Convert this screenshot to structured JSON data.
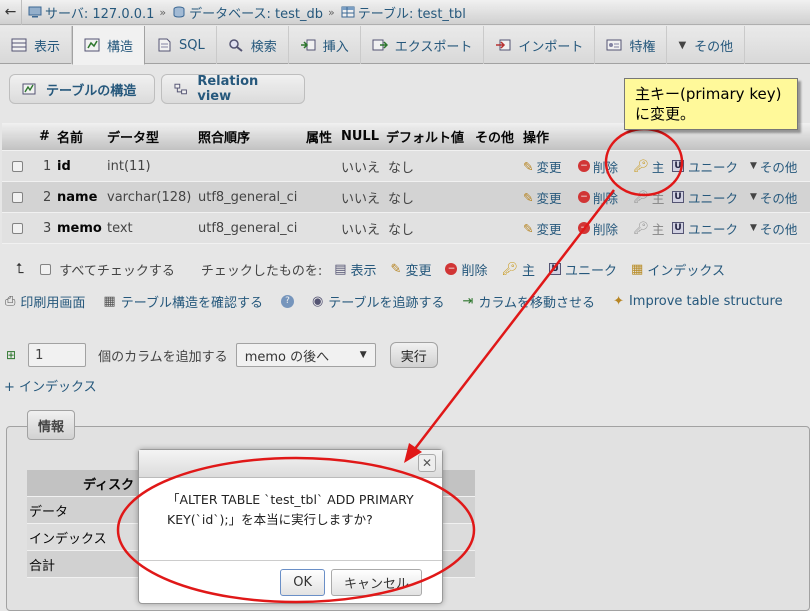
{
  "breadcrumb": {
    "server": "サーバ: 127.0.0.1",
    "database": "データベース: test_db",
    "table": "テーブル: test_tbl"
  },
  "tabs": [
    {
      "label": "表示"
    },
    {
      "label": "構造"
    },
    {
      "label": "SQL"
    },
    {
      "label": "検索"
    },
    {
      "label": "挿入"
    },
    {
      "label": "エクスポート"
    },
    {
      "label": "インポート"
    },
    {
      "label": "特権"
    },
    {
      "label": "その他"
    }
  ],
  "subnav": {
    "structure": "テーブルの構造",
    "relation": "Relation view"
  },
  "table": {
    "headers": [
      "#",
      "名前",
      "データ型",
      "照合順序",
      "属性",
      "NULL",
      "デフォルト値",
      "その他",
      "操作"
    ],
    "rows": [
      {
        "num": "1",
        "name": "id",
        "type": "int(11)",
        "collation": "",
        "null": "いいえ",
        "default": "なし"
      },
      {
        "num": "2",
        "name": "name",
        "type": "varchar(128)",
        "collation": "utf8_general_ci",
        "null": "いいえ",
        "default": "なし"
      },
      {
        "num": "3",
        "name": "memo",
        "type": "text",
        "collation": "utf8_general_ci",
        "null": "いいえ",
        "default": "なし"
      }
    ],
    "actions": {
      "change": "変更",
      "drop": "削除",
      "primary": "主",
      "unique": "ユニーク",
      "more": "その他"
    }
  },
  "checkall": {
    "check_all": "すべてチェックする",
    "with_selected": "チェックしたものを:",
    "browse": "表示",
    "change": "変更",
    "drop": "削除",
    "primary": "主",
    "unique": "ユニーク",
    "index": "インデックス"
  },
  "links": {
    "print": "印刷用画面",
    "propose": "テーブル構造を確認する",
    "track": "テーブルを追跡する",
    "move": "カラムを移動させる",
    "improve": "Improve table structure"
  },
  "addcol": {
    "count": "1",
    "text": "個のカラムを追加する",
    "position": "memo の後へ",
    "go": "実行"
  },
  "add_index": "+ インデックス",
  "info": {
    "legend": "情報",
    "space_header": "ディスク",
    "rows": [
      "データ",
      "インデックス",
      "合計"
    ]
  },
  "dialog": {
    "message": "「ALTER TABLE `test_tbl` ADD PRIMARY KEY(`id`);」を本当に実行しますか?",
    "ok": "OK",
    "cancel": "キャンセル"
  },
  "note": "主キー(primary key)に変更。",
  "colors": {
    "link": "#235a81",
    "annotation": "#e01818",
    "note_bg": "#fff99a"
  }
}
